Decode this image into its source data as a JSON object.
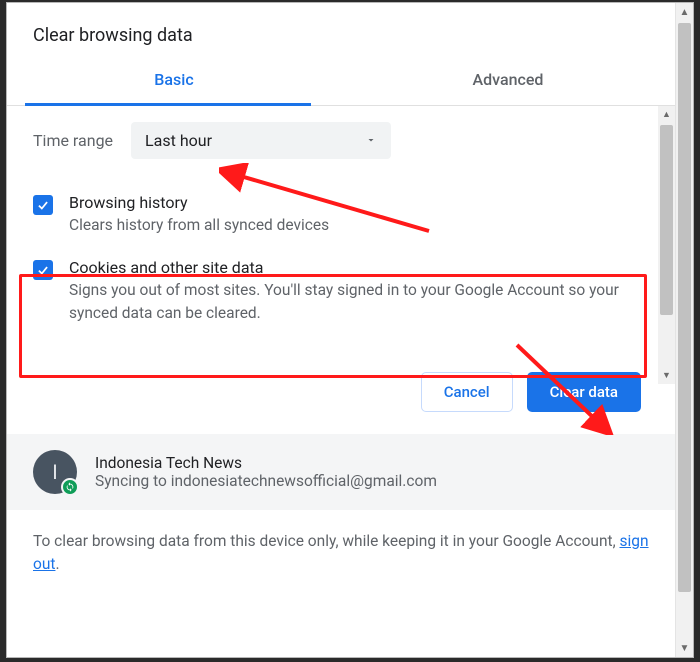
{
  "title": "Clear browsing data",
  "tabs": {
    "basic": "Basic",
    "advanced": "Advanced"
  },
  "time": {
    "label": "Time range",
    "value": "Last hour"
  },
  "options": [
    {
      "title": "Browsing history",
      "desc": "Clears history from all synced devices",
      "checked": true
    },
    {
      "title": "Cookies and other site data",
      "desc": "Signs you out of most sites. You'll stay signed in to your Google Account so your synced data can be cleared.",
      "checked": true
    }
  ],
  "buttons": {
    "cancel": "Cancel",
    "clear": "Clear data"
  },
  "account": {
    "initial": "I",
    "name": "Indonesia Tech News",
    "sync_prefix": "Syncing to ",
    "email": "indonesiatechnewsofficial@gmail.com"
  },
  "footnote": {
    "prefix": "To clear browsing data from this device only, while keeping it in your Google Account, ",
    "link": "sign out",
    "suffix": "."
  },
  "colors": {
    "accent": "#1a73e8",
    "annotation": "#ff1a1a",
    "success": "#0f9d58"
  }
}
